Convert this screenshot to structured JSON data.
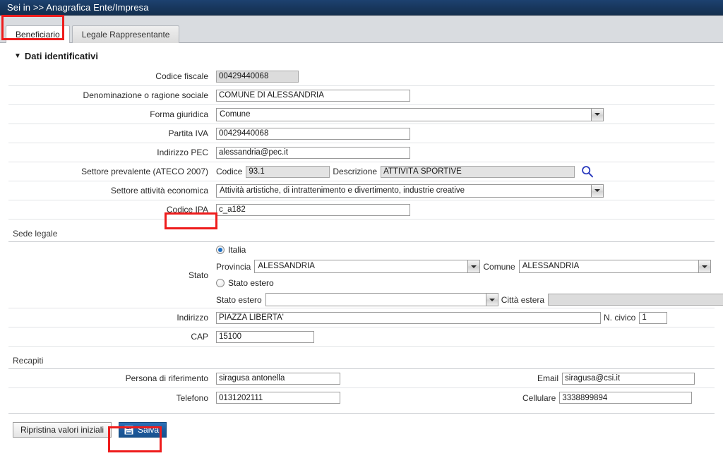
{
  "header": {
    "breadcrumb": "Sei in >> Anagrafica Ente/Impresa"
  },
  "tabs": [
    {
      "label": "Beneficiario",
      "active": true
    },
    {
      "label": "Legale Rappresentante",
      "active": false
    }
  ],
  "sections": {
    "dati_identificativi": {
      "title": "Dati identificativi",
      "caret": "▼",
      "fields": {
        "codice_fiscale": {
          "label": "Codice fiscale",
          "value": "00429440068"
        },
        "denominazione": {
          "label": "Denominazione o ragione sociale",
          "value": "COMUNE DI ALESSANDRIA"
        },
        "forma_giuridica": {
          "label": "Forma giuridica",
          "value": "Comune"
        },
        "partita_iva": {
          "label": "Partita IVA",
          "value": "00429440068"
        },
        "indirizzo_pec": {
          "label": "Indirizzo PEC",
          "value": "alessandria@pec.it"
        },
        "settore_prevalente": {
          "label": "Settore prevalente (ATECO 2007)",
          "codice_label": "Codice",
          "codice_value": "93.1",
          "descrizione_label": "Descrizione",
          "descrizione_value": "ATTIVITÀ SPORTIVE",
          "search_icon": "search-icon"
        },
        "settore_attivita": {
          "label": "Settore attività economica",
          "value": "Attività artistiche, di intrattenimento e divertimento, industrie creative"
        },
        "codice_ipa": {
          "label": "Codice IPA",
          "value": "c_a182"
        }
      }
    },
    "sede_legale": {
      "title": "Sede legale",
      "fields": {
        "stato": {
          "label": "Stato",
          "option_italia": {
            "label": "Italia",
            "selected": true
          },
          "option_estero": {
            "label": "Stato estero",
            "selected": false
          },
          "provincia_label": "Provincia",
          "provincia_value": "ALESSANDRIA",
          "comune_label": "Comune",
          "comune_value": "ALESSANDRIA",
          "stato_estero_label": "Stato estero",
          "stato_estero_value": "",
          "citta_estera_label": "Città estera",
          "citta_estera_value": ""
        },
        "indirizzo": {
          "label": "Indirizzo",
          "value": "PIAZZA LIBERTA'",
          "civico_label": "N. civico",
          "civico_value": "1"
        },
        "cap": {
          "label": "CAP",
          "value": "15100"
        }
      }
    },
    "recapiti": {
      "title": "Recapiti",
      "fields": {
        "persona": {
          "label": "Persona di riferimento",
          "value": "siragusa antonella"
        },
        "email": {
          "label": "Email",
          "value": "siragusa@csi.it"
        },
        "telefono": {
          "label": "Telefono",
          "value": "0131202111"
        },
        "cellulare": {
          "label": "Cellulare",
          "value": "3338899894"
        }
      }
    }
  },
  "footer": {
    "reset_label": "Ripristina valori iniziali",
    "save_label": "Salva",
    "save_icon": "save-floppy-icon"
  },
  "colors": {
    "header_blue": "#18375e",
    "annotation_red": "#ee1c1c",
    "save_blue": "#1d5a9e",
    "radio_blue": "#1d6fc4",
    "search_icon_blue": "#2233bb"
  }
}
